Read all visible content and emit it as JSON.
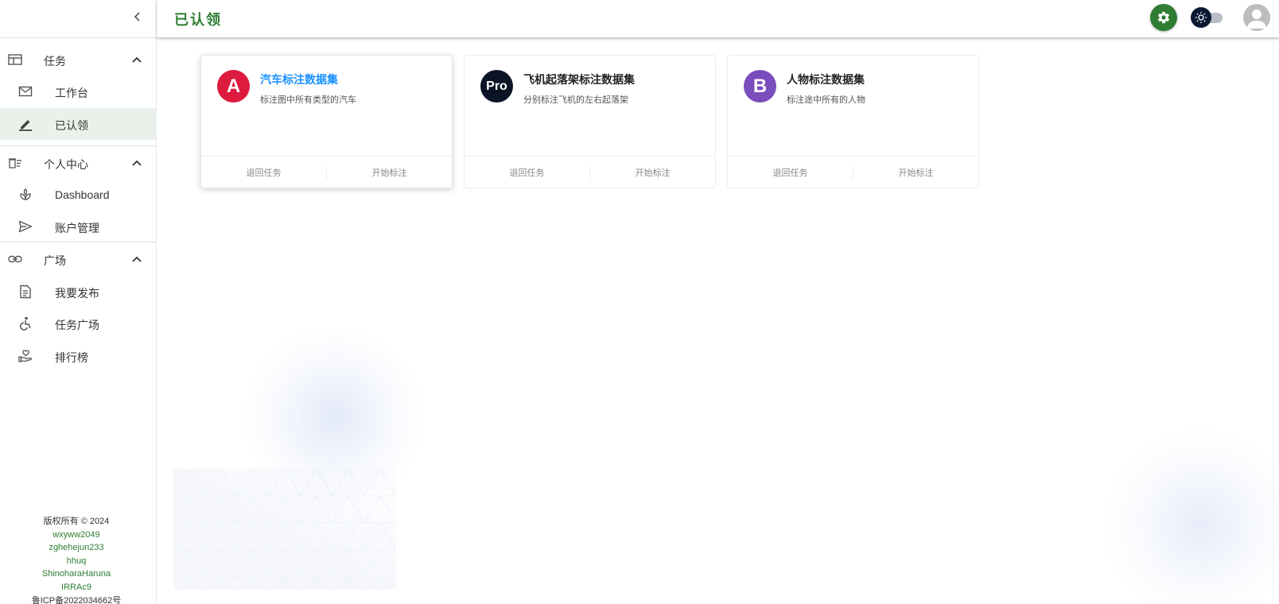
{
  "header": {
    "title": "已认领"
  },
  "sidebar": {
    "groups": [
      {
        "label": "任务",
        "items": [
          {
            "label": "工作台"
          },
          {
            "label": "已认领"
          }
        ]
      },
      {
        "label": "个人中心",
        "items": [
          {
            "label": "Dashboard"
          },
          {
            "label": "账户管理"
          }
        ]
      },
      {
        "label": "广场",
        "items": [
          {
            "label": "我要发布"
          },
          {
            "label": "任务广场"
          },
          {
            "label": "排行榜"
          }
        ]
      }
    ],
    "active_item": "已认领"
  },
  "footer": {
    "copyright": "版权所有 © 2024",
    "names": [
      "wxyww2049",
      "zghehejun233",
      "hhuq",
      "ShinoharaHaruna",
      "IRRAc9"
    ],
    "icp": "鲁ICP备2022034662号"
  },
  "cards": [
    {
      "logo_text": "A",
      "logo_color": "#dd1b3f",
      "title": "汽车标注数据集",
      "description": "标注图中所有类型的汽车",
      "actions": [
        "退回任务",
        "开始标注"
      ]
    },
    {
      "logo_text": "Pro",
      "logo_color": "#0b1424",
      "title": "飞机起落架标注数据集",
      "description": "分别标注飞机的左右起落架",
      "actions": [
        "退回任务",
        "开始标注"
      ]
    },
    {
      "logo_text": "B",
      "logo_color": "#7a4dbd",
      "title": "人物标注数据集",
      "description": "标注途中所有的人物",
      "actions": [
        "退回任务",
        "开始标注"
      ]
    }
  ],
  "colors": {
    "brand": "#2e7d32",
    "link": "#1890ff",
    "active_bg": "#eaf1ea"
  },
  "icons": {
    "collapse": "chevron-left-icon",
    "settings": "gear-icon",
    "theme": "sun-icon",
    "user": "user-avatar-icon"
  }
}
